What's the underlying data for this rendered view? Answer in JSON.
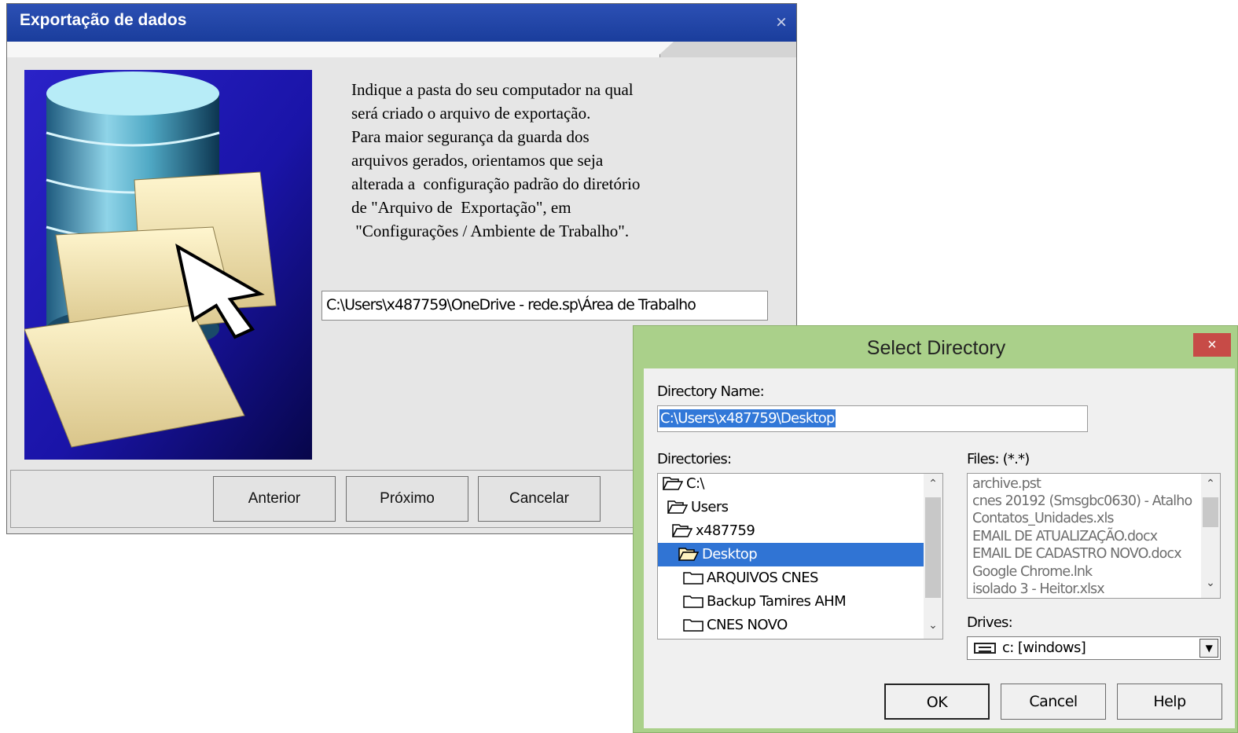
{
  "export_window": {
    "title": "Exportação de dados",
    "close_glyph": "×",
    "instructions": [
      "Indique a pasta do seu computador na qual",
      "será criado o arquivo de exportação.",
      "Para maior segurança da guarda dos",
      "arquivos gerados, orientamos que seja",
      "alterada a  configuração padrão do diretório",
      "de \"Arquivo de  Exportação\", em",
      " \"Configurações / Ambiente de Trabalho\"."
    ],
    "path_value": "C:\\Users\\x487759\\OneDrive - rede.sp\\Área de Trabalho",
    "buttons": {
      "previous": "Anterior",
      "next": "Próximo",
      "cancel": "Cancelar"
    },
    "illustration": "database-folder-cursor-illustration"
  },
  "select_directory": {
    "title": "Select Directory",
    "close_glyph": "×",
    "directory_name_label": "Directory Name:",
    "directory_name_value": "C:\\Users\\x487759\\Desktop",
    "directories_label": "Directories:",
    "directories": [
      {
        "name": "C:\\",
        "icon": "open-folder-icon",
        "selected": false
      },
      {
        "name": "Users",
        "icon": "open-folder-icon",
        "selected": false
      },
      {
        "name": "x487759",
        "icon": "open-folder-icon",
        "selected": false
      },
      {
        "name": "Desktop",
        "icon": "open-folder-icon",
        "selected": true
      },
      {
        "name": "ARQUIVOS CNES",
        "icon": "folder-icon",
        "selected": false
      },
      {
        "name": "Backup Tamires AHM",
        "icon": "folder-icon",
        "selected": false
      },
      {
        "name": "CNES NOVO",
        "icon": "folder-icon",
        "selected": false
      }
    ],
    "files_label": "Files: (*.*)",
    "files": [
      "archive.pst",
      "cnes 20192 (Smsgbc0630) - Atalho",
      "Contatos_Unidades.xls",
      "EMAIL DE ATUALIZAÇÃO.docx",
      "EMAIL DE CADASTRO NOVO.docx",
      "Google Chrome.lnk",
      "isolado 3 - Heitor.xlsx"
    ],
    "drives_label": "Drives:",
    "drive_value": "c: [windows]",
    "buttons": {
      "ok": "OK",
      "cancel": "Cancel",
      "help": "Help"
    },
    "colors": {
      "frame": "#aad08a",
      "selection": "#3074d4",
      "close": "#c74b47"
    }
  }
}
